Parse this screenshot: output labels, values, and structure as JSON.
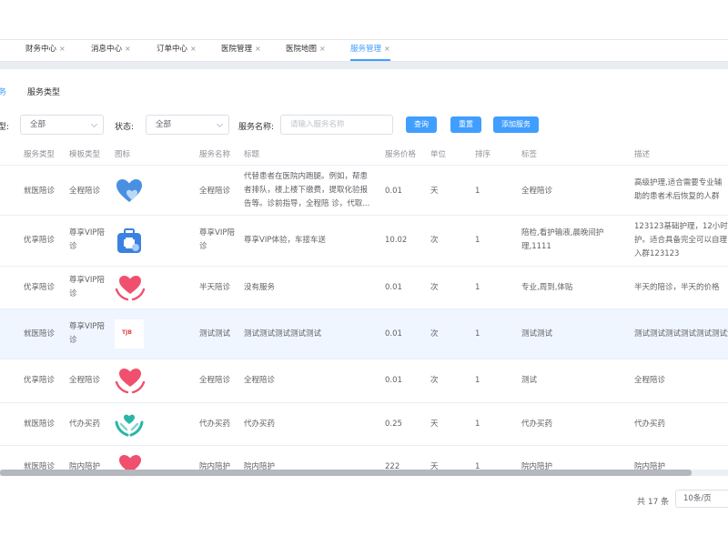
{
  "tabs": [
    {
      "label": "财务中心"
    },
    {
      "label": "消息中心"
    },
    {
      "label": "订单中心"
    },
    {
      "label": "医院管理"
    },
    {
      "label": "医院地图"
    },
    {
      "label": "服务管理"
    }
  ],
  "tab_close": "×",
  "subtabs": {
    "first": "务",
    "second": "服务类型"
  },
  "filters": {
    "type_label": "型:",
    "type_value": "全部",
    "status_label": "状态:",
    "status_value": "全部",
    "name_label": "服务名称:",
    "name_placeholder": "请输入服务名称",
    "query_btn": "查询",
    "reset_btn": "重置",
    "add_btn": "添加服务"
  },
  "columns": {
    "service_type": "服务类型",
    "template_type": "模板类型",
    "icon": "图标",
    "service_name": "服务名称",
    "title": "标题",
    "price": "服务价格",
    "unit": "单位",
    "sort": "排序",
    "tags": "标签",
    "desc": "描述"
  },
  "rows": [
    {
      "service_type": "就医陪诊",
      "template_type": "全程陪诊",
      "icon": "blue-heart-icon",
      "service_name": "全程陪诊",
      "title": "代替患者在医院内跑腿。例如，帮患者排队，楼上楼下缴费，提取化验报告等。诊前指导，全程陪 诊，代取...",
      "price": "0.01",
      "unit": "天",
      "sort": "1",
      "tags": "全程陪诊",
      "desc": "高级护理,适合需要专业辅助的患者术后恢复的人群"
    },
    {
      "service_type": "优享陪诊",
      "template_type": "尊享VIP陪诊",
      "icon": "medical-kit-icon",
      "service_name": "尊享VIP陪诊",
      "title": "尊享VIP体验，车接车送",
      "price": "10.02",
      "unit": "次",
      "sort": "1",
      "tags": "陪检,看护输液,晨晚间护理,1111",
      "desc": "123123基础护理，12小时护。适合具备完全可以自理入群123123"
    },
    {
      "service_type": "优享陪诊",
      "template_type": "尊享VIP陪诊",
      "icon": "pink-heart-hands-icon",
      "service_name": "半天陪诊",
      "title": "没有服务",
      "price": "0.01",
      "unit": "次",
      "sort": "1",
      "tags": "专业,周到,体贴",
      "desc": "半天的陪诊，半天的价格"
    },
    {
      "service_type": "就医陪诊",
      "template_type": "尊享VIP陪诊",
      "icon": "logo-icon",
      "icon_text": "TJB",
      "service_name": "测试测试",
      "title": "测试测试测试测试测试",
      "price": "0.01",
      "unit": "次",
      "sort": "1",
      "tags": "测试测试",
      "desc": "测试测试测试测试测试测试测试"
    },
    {
      "service_type": "优享陪诊",
      "template_type": "全程陪诊",
      "icon": "pink-heart-hands-icon",
      "service_name": "全程陪诊",
      "title": "全程陪诊",
      "price": "0.01",
      "unit": "次",
      "sort": "1",
      "tags": "测试",
      "desc": "全程陪诊"
    },
    {
      "service_type": "就医陪诊",
      "template_type": "代办买药",
      "icon": "teal-hands-heart-icon",
      "service_name": "代办买药",
      "title": "代办买药",
      "price": "0.25",
      "unit": "天",
      "sort": "1",
      "tags": "代办买药",
      "desc": "代办买药"
    },
    {
      "service_type": "就医陪诊",
      "template_type": "院内陪护",
      "icon": "pink-heart-hands-icon",
      "service_name": "院内陪护",
      "title": "院内陪护",
      "price": "222",
      "unit": "天",
      "sort": "1",
      "tags": "院内陪护",
      "desc": "院内陪护"
    }
  ],
  "pagination": {
    "total": "共 17 条",
    "page_size": "10条/页"
  },
  "colors": {
    "primary": "#409eff",
    "heart_pink": "#f0506e",
    "heart_blue": "#4a90e2",
    "teal": "#2bb5a8"
  }
}
